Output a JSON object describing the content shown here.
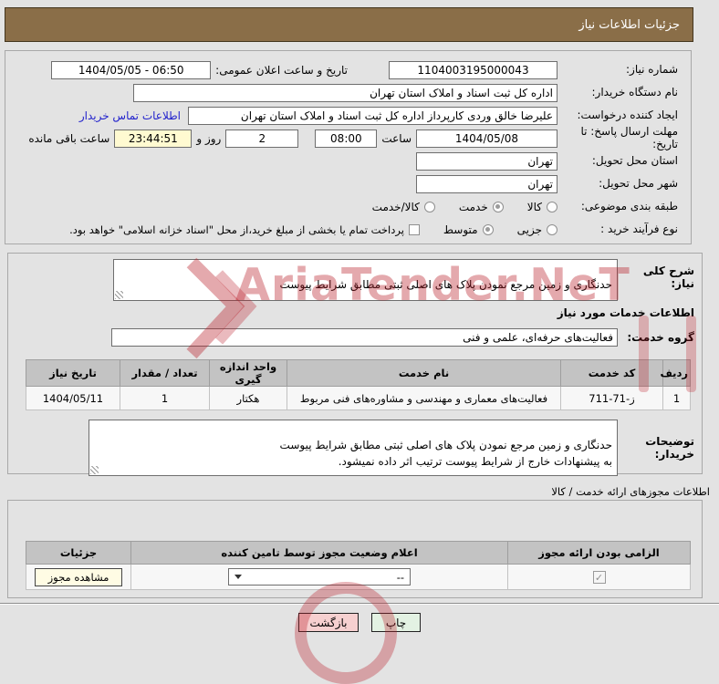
{
  "title": "جزئیات اطلاعات نیاز",
  "colors": {
    "titlebar": "#8a6e48",
    "link": "#2222cc",
    "countdown_bg": "#fffad1",
    "back_button": "#f6d0d0",
    "print_button": "#e3f2e3",
    "watermark_red": "#b91c28"
  },
  "watermark": {
    "text": "AriaTender.NeT"
  },
  "section1": {
    "need_number": {
      "label": "شماره نیاز:",
      "value": "1104003195000043"
    },
    "announce": {
      "label": "تاریخ و ساعت اعلان عمومی:",
      "value": "1404/05/05 - 06:50"
    },
    "buyer_org": {
      "label": "نام دستگاه خریدار:",
      "value": "اداره کل ثبت اسناد و املاک استان تهران"
    },
    "creator": {
      "label": "ایجاد کننده درخواست:",
      "value": "علیرضا خالق وردی کارپرداز اداره کل ثبت اسناد و املاک استان تهران"
    },
    "contact_link": "اطلاعات تماس خریدار",
    "deadline": {
      "label": "مهلت ارسال پاسخ: تا تاریخ:",
      "date": "1404/05/08",
      "hour_label": "ساعت",
      "time": "08:00",
      "days": "2",
      "days_label": "روز و",
      "remaining": "23:44:51",
      "remaining_label": "ساعت باقی مانده"
    },
    "province": {
      "label": "استان محل تحویل:",
      "value": "تهران"
    },
    "city": {
      "label": "شهر محل تحویل:",
      "value": "تهران"
    },
    "classification": {
      "label": "طبقه بندی موضوعی:",
      "options": [
        {
          "label": "کالا",
          "selected": false
        },
        {
          "label": "خدمت",
          "selected": true
        },
        {
          "label": "کالا/خدمت",
          "selected": false
        }
      ]
    },
    "process_type": {
      "label": "نوع فرآیند خرید :",
      "options": [
        {
          "label": "جزیی",
          "selected": false
        },
        {
          "label": "متوسط",
          "selected": true
        }
      ],
      "checkbox_checked": false,
      "checkbox_label": "پرداخت تمام یا بخشی از مبلغ خرید،از محل \"اسناد خزانه اسلامی\" خواهد بود."
    }
  },
  "section2": {
    "general_desc": {
      "label": "شرح کلی نیاز:",
      "value": "حدنگاری و زمین مرجع نمودن پلاک های اصلی ثبتی مطابق شرایط پیوست"
    },
    "services_header": "اطلاعات خدمات مورد نیاز",
    "service_group": {
      "label": "گروه خدمت:",
      "value": "فعالیت‌های حرفه‌ای، علمی و فنی"
    },
    "table": {
      "headers": [
        "ردیف",
        "کد خدمت",
        "نام خدمت",
        "واحد اندازه گیری",
        "تعداد / مقدار",
        "تاریخ نیاز"
      ],
      "rows": [
        [
          "1",
          "711-71-ز",
          "فعالیت‌های معماری و مهندسی و مشاوره‌های فنی مربوط",
          "هکتار",
          "1",
          "1404/05/11"
        ]
      ]
    },
    "buyer_notes": {
      "label": "توضیحات خریدار:",
      "value": "حدنگاری و زمین مرجع نمودن پلاک های اصلی ثبتی مطابق شرایط پیوست\nبه پیشنهادات خارج از شرایط پیوست ترتیب اثر داده نمیشود."
    }
  },
  "section3": {
    "header": "اطلاعات مجوزهای ارائه خدمت / کالا",
    "table_headers": [
      "الزامی بودن ارائه مجوز",
      "اعلام وضعیت مجوز توسط تامین کننده",
      "جزئیات"
    ],
    "row": {
      "mandatory_checked": true,
      "status_value": "--",
      "details_button": "مشاهده مجوز"
    }
  },
  "footer": {
    "print": "چاپ",
    "back": "بازگشت"
  }
}
